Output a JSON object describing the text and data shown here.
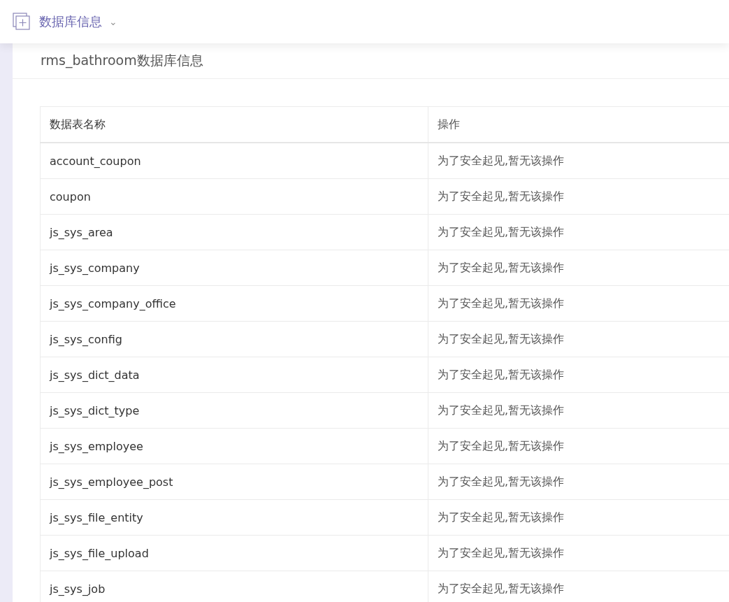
{
  "header": {
    "title": "数据库信息",
    "caret": "⌄"
  },
  "card": {
    "title": "rms_bathroom数据库信息"
  },
  "table": {
    "columns": [
      "数据表名称",
      "操作"
    ],
    "rows": [
      {
        "name": "account_coupon",
        "action": "为了安全起见,暂无该操作"
      },
      {
        "name": "coupon",
        "action": "为了安全起见,暂无该操作"
      },
      {
        "name": "js_sys_area",
        "action": "为了安全起见,暂无该操作"
      },
      {
        "name": "js_sys_company",
        "action": "为了安全起见,暂无该操作"
      },
      {
        "name": "js_sys_company_office",
        "action": "为了安全起见,暂无该操作"
      },
      {
        "name": "js_sys_config",
        "action": "为了安全起见,暂无该操作"
      },
      {
        "name": "js_sys_dict_data",
        "action": "为了安全起见,暂无该操作"
      },
      {
        "name": "js_sys_dict_type",
        "action": "为了安全起见,暂无该操作"
      },
      {
        "name": "js_sys_employee",
        "action": "为了安全起见,暂无该操作"
      },
      {
        "name": "js_sys_employee_post",
        "action": "为了安全起见,暂无该操作"
      },
      {
        "name": "js_sys_file_entity",
        "action": "为了安全起见,暂无该操作"
      },
      {
        "name": "js_sys_file_upload",
        "action": "为了安全起见,暂无该操作"
      },
      {
        "name": "js_sys_job",
        "action": "为了安全起见,暂无该操作"
      }
    ]
  }
}
